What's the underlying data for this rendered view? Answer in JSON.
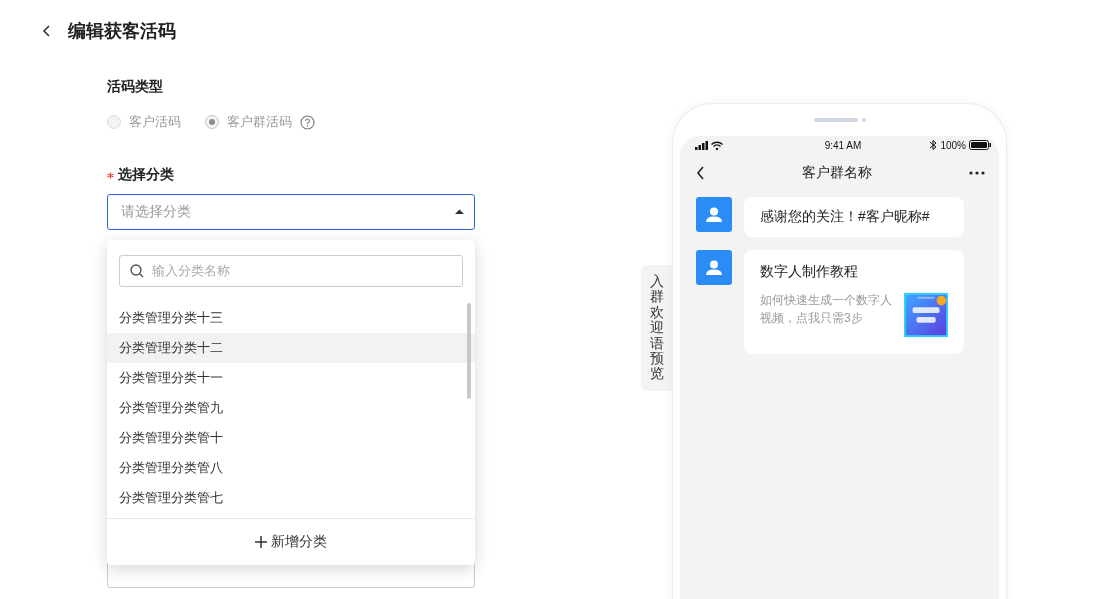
{
  "header": {
    "title": "编辑获客活码"
  },
  "form": {
    "type_field": {
      "label": "活码类型",
      "options": [
        {
          "label": "客户活码",
          "selected": false,
          "disabled": true,
          "help": false
        },
        {
          "label": "客户群活码",
          "selected": true,
          "disabled": true,
          "help": true
        }
      ]
    },
    "category_field": {
      "label": "选择分类",
      "required": true,
      "placeholder": "请选择分类",
      "expanded": true
    },
    "dropdown": {
      "search_placeholder": "输入分类名称",
      "items": [
        {
          "label": "分类管理分类十三",
          "selected": false
        },
        {
          "label": "分类管理分类十二",
          "selected": true
        },
        {
          "label": "分类管理分类十一",
          "selected": false
        },
        {
          "label": "分类管理分类管九",
          "selected": false
        },
        {
          "label": "分类管理分类管十",
          "selected": false
        },
        {
          "label": "分类管理分类管八",
          "selected": false
        },
        {
          "label": "分类管理分类管七",
          "selected": false
        }
      ],
      "add_label": "新增分类"
    }
  },
  "preview_tab": {
    "label": "入群欢迎语预览"
  },
  "phone": {
    "time": "9:41 AM",
    "battery": "100%",
    "chat_title": "客户群名称",
    "messages": [
      {
        "kind": "text",
        "text": "感谢您的关注！#客户昵称#"
      },
      {
        "kind": "link",
        "title": "数字人制作教程",
        "description": "如何快速生成一个数字人视频，点我只需3步"
      }
    ]
  }
}
